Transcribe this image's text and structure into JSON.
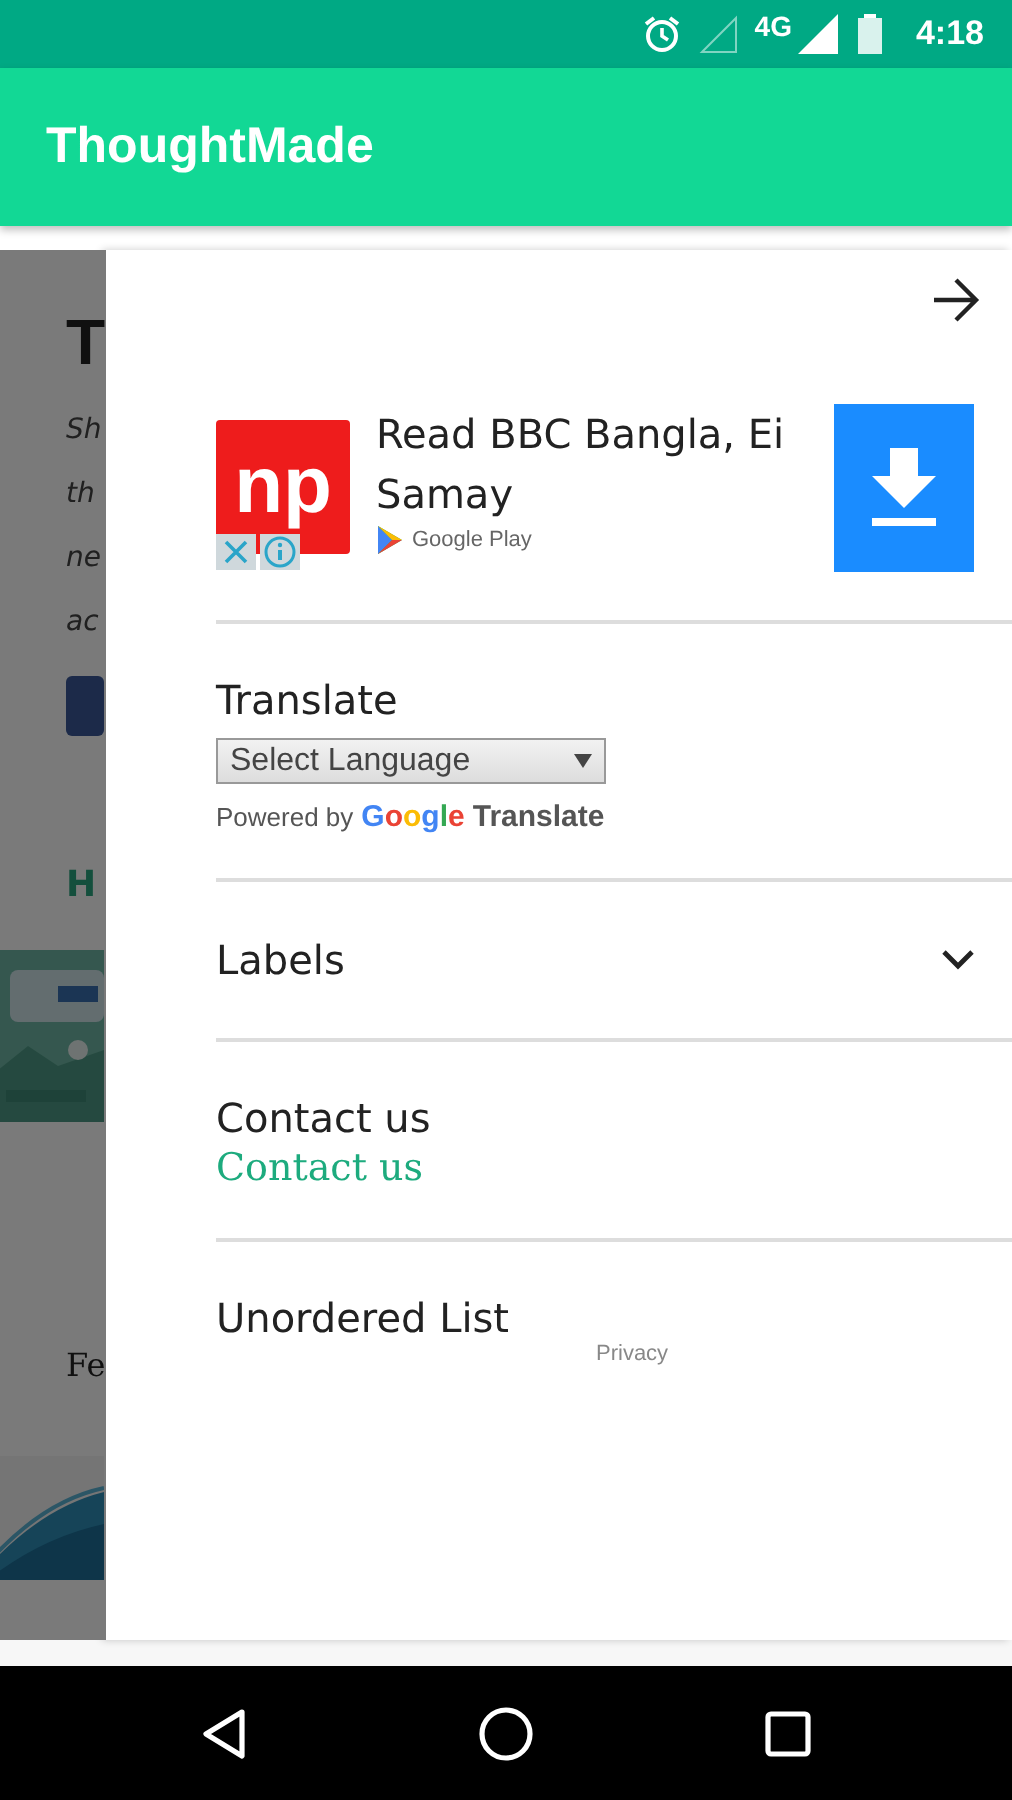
{
  "status_bar": {
    "network": "4G",
    "time": "4:18"
  },
  "app_bar": {
    "title": "ThoughtMade"
  },
  "background_page": {
    "heading": "T",
    "lines": [
      "Sh",
      "th",
      "ne",
      "ac"
    ],
    "link": "H",
    "subheading": "Fe"
  },
  "drawer": {
    "ad": {
      "logo": "np",
      "title": "Read BBC Bangla, Ei Samay",
      "store": "Google Play"
    },
    "translate": {
      "title": "Translate",
      "select": "Select Language",
      "powered_by": "Powered by",
      "brand": "Google",
      "product": "Translate"
    },
    "labels": {
      "title": "Labels",
      "expanded": false
    },
    "contact": {
      "title": "Contact us",
      "link": "Contact us"
    },
    "list": {
      "title": "Unordered List"
    },
    "privacy": "Privacy"
  }
}
